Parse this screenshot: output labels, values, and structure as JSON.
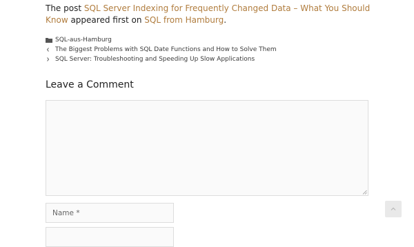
{
  "intro": {
    "prefix": "The post ",
    "post_link": "SQL Server Indexing for Frequently Changed Data – What You Should Know",
    "middle": " appeared first on ",
    "site_link": "SQL from Hamburg",
    "suffix": "."
  },
  "meta": {
    "category_icon": "folder-icon",
    "category": "SQL-aus-Hamburg",
    "prev_icon": "chevron-left-icon",
    "prev_post": "The Biggest Problems with SQL Date Functions and How to Solve Them",
    "next_icon": "chevron-right-icon",
    "next_post": "SQL Server: Troubleshooting and Speeding Up Slow Applications"
  },
  "comment_section": {
    "heading": "Leave a Comment",
    "comment_value": "",
    "name_placeholder": "Name *",
    "email_placeholder": ""
  },
  "back_to_top": {
    "icon": "chevron-up-icon"
  },
  "colors": {
    "link": "#b07c3d",
    "text": "#222222",
    "field_border": "#dddddd",
    "field_bg": "#fafafa"
  }
}
